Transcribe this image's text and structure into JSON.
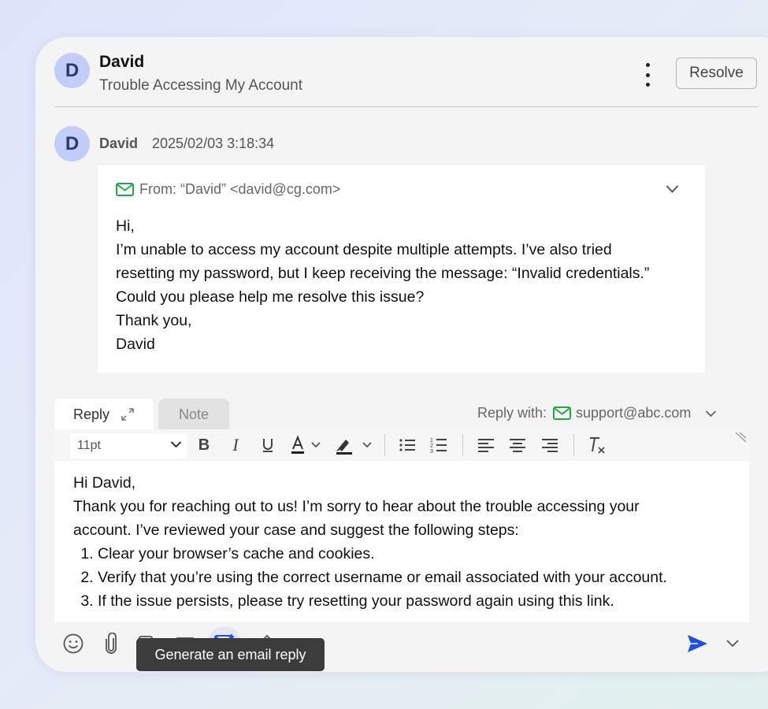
{
  "header": {
    "avatar_initial": "D",
    "sender_name": "David",
    "subject": "Trouble Accessing My Account",
    "resolve_label": "Resolve"
  },
  "message": {
    "avatar_initial": "D",
    "sender_name": "David",
    "timestamp": "2025/02/03 3:18:34",
    "from_line": "From: “David” <david@cg.com>",
    "body_lines": [
      "Hi,",
      "I’m unable to access my account despite multiple attempts. I’ve also tried",
      "resetting my password, but I keep receiving the message: “Invalid credentials.”",
      "Could you please help me resolve this issue?",
      "Thank you,",
      "David"
    ]
  },
  "composer": {
    "tabs": [
      {
        "label": "Reply",
        "active": true
      },
      {
        "label": "Note",
        "active": false
      }
    ],
    "reply_with_label": "Reply with:",
    "reply_with_address": "support@abc.com",
    "font_size": "11pt",
    "toolbar_icons": [
      "bold-icon",
      "italic-icon",
      "underline-icon",
      "text-color-icon",
      "highlight-icon",
      "bulleted-list-icon",
      "numbered-list-icon",
      "align-left-icon",
      "align-center-icon",
      "align-right-icon",
      "clear-formatting-icon"
    ],
    "greeting": "Hi David,",
    "paragraph_lines": [
      "Thank you for reaching out to us! I’m sorry to hear about the trouble accessing your",
      "account. I’ve reviewed your case and suggest the following steps:"
    ],
    "steps": [
      "Clear your browser’s cache and cookies.",
      "Verify that you’re using the correct username or email associated with your account.",
      "If the issue persists, please try resetting your password again using this link."
    ],
    "bottom_icons": [
      "emoji-icon",
      "attachment-icon",
      "template-icon",
      "canned-response-icon",
      "ai-email-icon",
      "edit-icon",
      "send-icon",
      "chevron-down-icon"
    ],
    "tooltip": "Generate an email reply"
  },
  "colors": {
    "accent_green": "#22a845",
    "avatar_bg": "#c2cdf9",
    "send_blue": "#1f4fe0",
    "tooltip_bg": "#3c3c3c"
  }
}
